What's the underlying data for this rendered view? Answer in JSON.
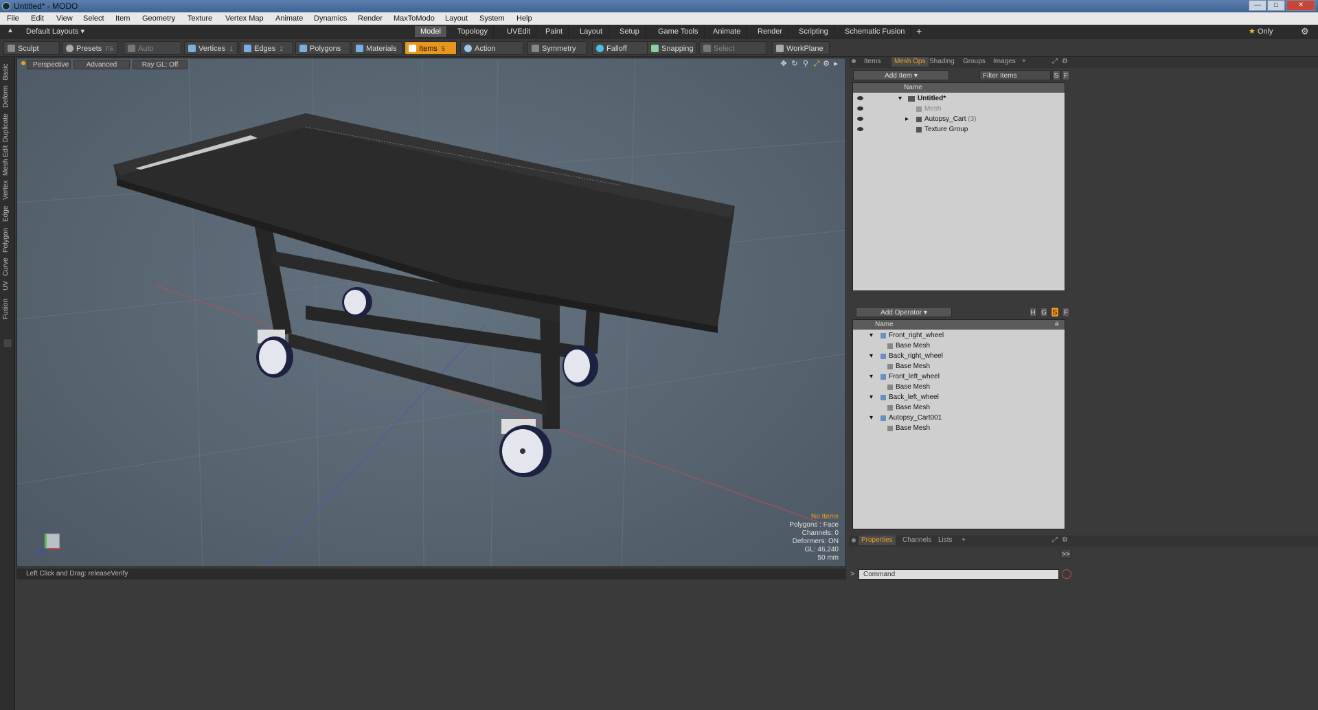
{
  "window": {
    "title": "Untitled* - MODO"
  },
  "menu": [
    "File",
    "Edit",
    "View",
    "Select",
    "Item",
    "Geometry",
    "Texture",
    "Vertex Map",
    "Animate",
    "Dynamics",
    "Render",
    "MaxToModo",
    "Layout",
    "System",
    "Help"
  ],
  "layoutbar": {
    "preset": "Default Layouts",
    "tabs": [
      "Model",
      "Topology",
      "UVEdit",
      "Paint",
      "Layout",
      "Setup",
      "Game Tools",
      "Animate",
      "Render",
      "Scripting",
      "Schematic Fusion"
    ],
    "active_tab": "Model",
    "only_label": "Only"
  },
  "toolbar": {
    "sculpt": "Sculpt",
    "presets": "Presets",
    "presets_key": "F6",
    "auto_select": "Auto Select",
    "vertices": "Vertices",
    "vertices_count": "1",
    "edges": "Edges",
    "edges_count": "2",
    "polygons": "Polygons",
    "materials": "Materials",
    "items": "Items",
    "items_count": "5",
    "action_center": "Action Center",
    "symmetry": "Symmetry",
    "falloff": "Falloff",
    "snapping": "Snapping",
    "select_through": "Select Through",
    "workplane": "WorkPlane"
  },
  "left_tabs": [
    "Basic",
    "Deform",
    "Duplicate",
    "Mesh Edit",
    "Vertex",
    "Edge",
    "Polygon",
    "Curve",
    "UV",
    "Fusion"
  ],
  "viewport": {
    "view": "Perspective",
    "advanced": "Advanced",
    "raygl": "Ray GL: Off",
    "info": {
      "no_items": "No Items",
      "polygons": "Polygons : Face",
      "channels": "Channels: 0",
      "deformers": "Deformers: ON",
      "gl": "GL: 46,240",
      "lens": "50 mm"
    }
  },
  "status": {
    "hint": "Left Click and Drag:  releaseVerify"
  },
  "items_panel": {
    "tabs": [
      "Items",
      "Mesh Ops",
      "Shading",
      "Groups",
      "Images"
    ],
    "active_tab": "Mesh Ops",
    "add_item": "Add Item",
    "filter": "Filter Items",
    "s_btn": "S",
    "f_btn": "F",
    "col_name": "Name",
    "tree": [
      {
        "label": "Untitled*",
        "level": 0,
        "bold": true
      },
      {
        "label": "Mesh",
        "level": 1,
        "dim": true
      },
      {
        "label": "Autopsy_Cart",
        "count": "(3)",
        "level": 1
      },
      {
        "label": "Texture Group",
        "level": 1
      }
    ]
  },
  "ops_panel": {
    "add_operator": "Add Operator",
    "buttons": [
      "H",
      "G",
      "S",
      "F"
    ],
    "col_name": "Name",
    "col_hash": "#",
    "tree": [
      {
        "label": "Front_right_wheel",
        "level": 0
      },
      {
        "label": "Base Mesh",
        "level": 1
      },
      {
        "label": "Back_right_wheel",
        "level": 0
      },
      {
        "label": "Base Mesh",
        "level": 1
      },
      {
        "label": "Front_left_wheel",
        "level": 0
      },
      {
        "label": "Base Mesh",
        "level": 1
      },
      {
        "label": "Back_left_wheel",
        "level": 0
      },
      {
        "label": "Base Mesh",
        "level": 1
      },
      {
        "label": "Autopsy_Cart001",
        "level": 0
      },
      {
        "label": "Base Mesh",
        "level": 1
      }
    ]
  },
  "bottom_panel": {
    "tabs": [
      "Properties",
      "Channels",
      "Lists"
    ],
    "active_tab": "Properties",
    "command_placeholder": "Command",
    "expand": ">>"
  }
}
